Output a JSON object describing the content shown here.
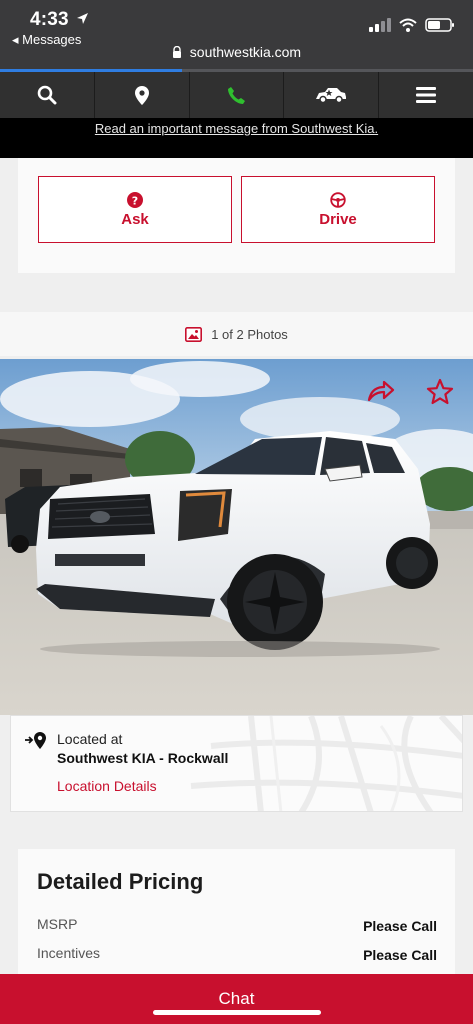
{
  "status_bar": {
    "time": "4:33",
    "back_app": "◂ Messages",
    "url": "southwestkia.com",
    "load_progress": 0.385
  },
  "nav": {
    "items": [
      {
        "icon": "search-icon",
        "color": "#ffffff"
      },
      {
        "icon": "map-pin-icon",
        "color": "#ffffff"
      },
      {
        "icon": "phone-icon",
        "color": "#2fbf2f"
      },
      {
        "icon": "car-icon",
        "color": "#ffffff"
      },
      {
        "icon": "menu-icon",
        "color": "#ffffff"
      }
    ]
  },
  "notice": {
    "text": "Read an important message from Southwest Kia."
  },
  "actions": {
    "ask_label": "Ask",
    "drive_label": "Drive"
  },
  "photos": {
    "count_text": "1 of 2 Photos"
  },
  "location": {
    "label": "Located at",
    "dealer": "Southwest KIA - Rockwall",
    "link": "Location Details"
  },
  "pricing": {
    "title": "Detailed Pricing",
    "rows": [
      {
        "label": "MSRP",
        "value": "Please Call"
      },
      {
        "label": "Incentives",
        "value": "Please Call"
      }
    ]
  },
  "chat": {
    "label": "Chat"
  },
  "colors": {
    "brand_red": "#c8102e",
    "nav_bg": "#303030",
    "progress_blue": "#2f7de1"
  }
}
